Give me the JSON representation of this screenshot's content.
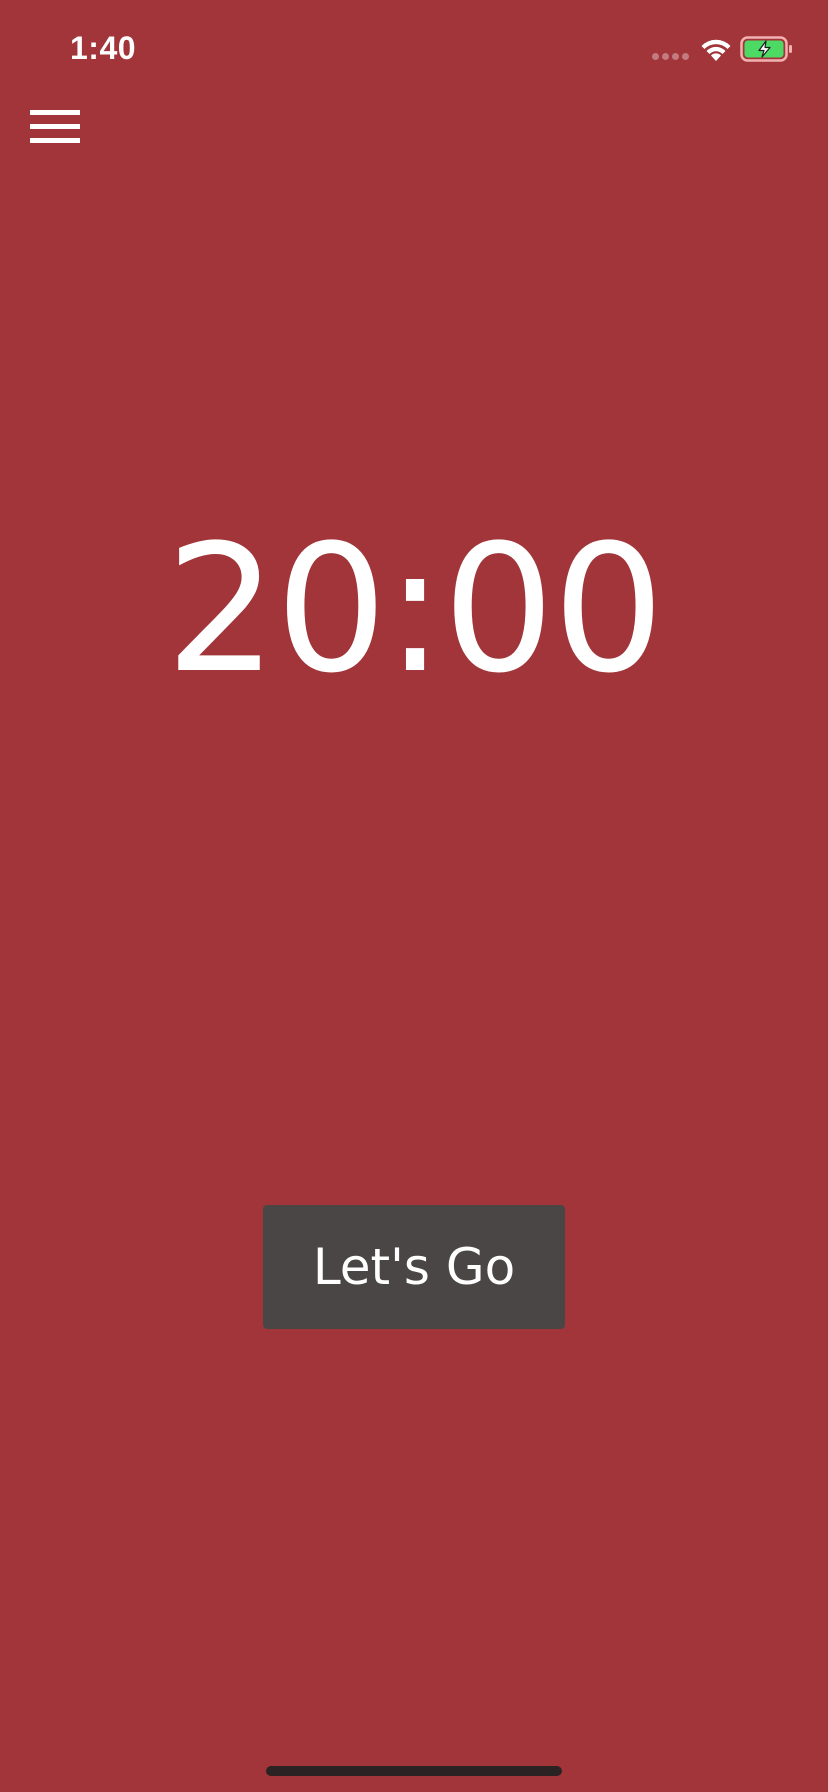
{
  "status_bar": {
    "time": "1:40",
    "wifi_icon": "wifi-icon",
    "battery_icon": "battery-charging-icon",
    "battery_level": 0.8,
    "battery_color": "#4cd964"
  },
  "menu": {
    "icon": "hamburger-menu-icon"
  },
  "timer": {
    "display": "20:00"
  },
  "actions": {
    "start_label": "Let's Go"
  },
  "colors": {
    "background": "#a13539",
    "button": "#4a4646",
    "text": "#ffffff"
  }
}
